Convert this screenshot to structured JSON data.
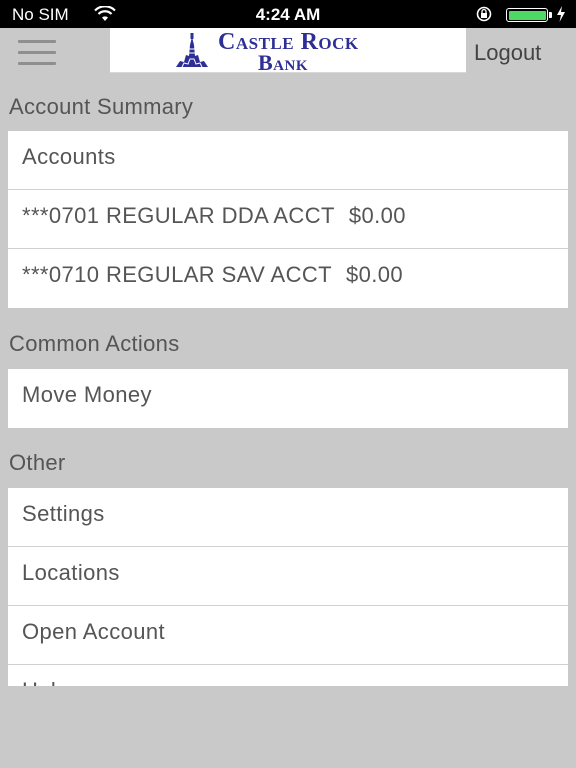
{
  "status_bar": {
    "carrier": "No SIM",
    "time": "4:24 AM",
    "battery_level": 1.0,
    "battery_color": "#4cd964"
  },
  "header": {
    "menu_icon": "hamburger-menu-icon",
    "logo_line1": "Castle Rock",
    "logo_line2": "Bank",
    "logo_color": "#2d2f96",
    "logout_label": "Logout"
  },
  "account_summary": {
    "title": "Account Summary",
    "items": [
      {
        "label": "Accounts",
        "amount": ""
      },
      {
        "label": "***0701 REGULAR DDA ACCT",
        "amount": "$0.00"
      },
      {
        "label": "***0710 REGULAR SAV ACCT",
        "amount": "$0.00"
      }
    ]
  },
  "common_actions": {
    "title": "Common Actions",
    "items": [
      {
        "label": "Move Money"
      }
    ]
  },
  "other": {
    "title": "Other",
    "items": [
      {
        "label": "Settings"
      },
      {
        "label": "Locations"
      },
      {
        "label": "Open Account"
      },
      {
        "label": "Help"
      }
    ]
  }
}
